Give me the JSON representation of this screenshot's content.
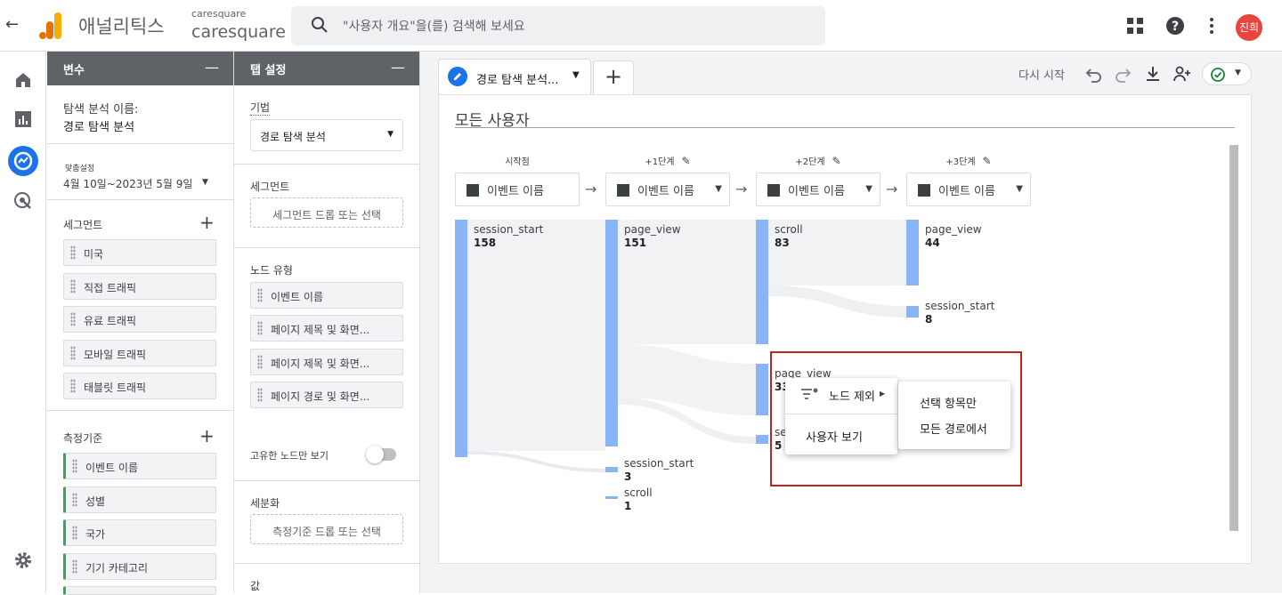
{
  "topbar": {
    "brand": "애널리틱스",
    "account_small": "caresquare",
    "account_big": "caresquare",
    "search_placeholder": "\"사용자 개요\"을(를) 검색해 보세요",
    "avatar": "진희"
  },
  "variables": {
    "header": "변수",
    "exploration_name_label": "탐색 분석 이름:",
    "exploration_name": "경로 탐색 분석",
    "custom_label": "맞춤설정",
    "date_range": "4월 10일~2023년 5월 9일",
    "segments_label": "세그먼트",
    "segments": [
      "미국",
      "직접 트래픽",
      "유료 트래픽",
      "모바일 트래픽",
      "태블릿 트래픽"
    ],
    "metrics_label": "측정기준",
    "metrics": [
      "이벤트 이름",
      "성별",
      "국가",
      "기기 카테고리"
    ]
  },
  "tab_settings": {
    "header": "탭 설정",
    "technique_label": "기법",
    "technique": "경로 탐색 분석",
    "segment_label": "세그먼트",
    "segment_drop": "세그먼트 드롭 또는 선택",
    "node_type_label": "노드 유형",
    "node_types": [
      "이벤트 이름",
      "페이지 제목 및 화면...",
      "페이지 제목 및 화면...",
      "페이지 경로 및 화면..."
    ],
    "unique_nodes_label": "고유한 노드만 보기",
    "breakdown_label": "세분화",
    "breakdown_drop": "측정기준 드롭 또는 선택",
    "values_label": "값"
  },
  "canvas": {
    "tab_title": "경로 탐색 분석...",
    "restart": "다시 시작",
    "segment_title": "모든 사용자",
    "steps": [
      {
        "label": "시작점",
        "selector": "이벤트 이름"
      },
      {
        "label": "+1단계",
        "selector": "이벤트 이름"
      },
      {
        "label": "+2단계",
        "selector": "이벤트 이름"
      },
      {
        "label": "+3단계",
        "selector": "이벤트 이름"
      }
    ],
    "nodes": {
      "s0": {
        "name": "session_start",
        "value": "158"
      },
      "s1a": {
        "name": "page_view",
        "value": "151"
      },
      "s1b": {
        "name": "session_start",
        "value": "3"
      },
      "s1c": {
        "name": "scroll",
        "value": "1"
      },
      "s2a": {
        "name": "scroll",
        "value": "83"
      },
      "s2b": {
        "name": "page_view",
        "value": "33"
      },
      "s2c": {
        "name": "se",
        "value": "5"
      },
      "s3a": {
        "name": "page_view",
        "value": "44"
      },
      "s3b": {
        "name": "session_start",
        "value": "8"
      }
    },
    "context_menu": {
      "exclude_node": "노드 제외",
      "view_users": "사용자 보기",
      "only_selected": "선택 항목만",
      "from_all_paths": "모든 경로에서"
    }
  },
  "colors": {
    "accent": "#1a73e8",
    "node": "#8ab4f8",
    "highlight": "#c5221f",
    "avatar": "#e8453c"
  }
}
